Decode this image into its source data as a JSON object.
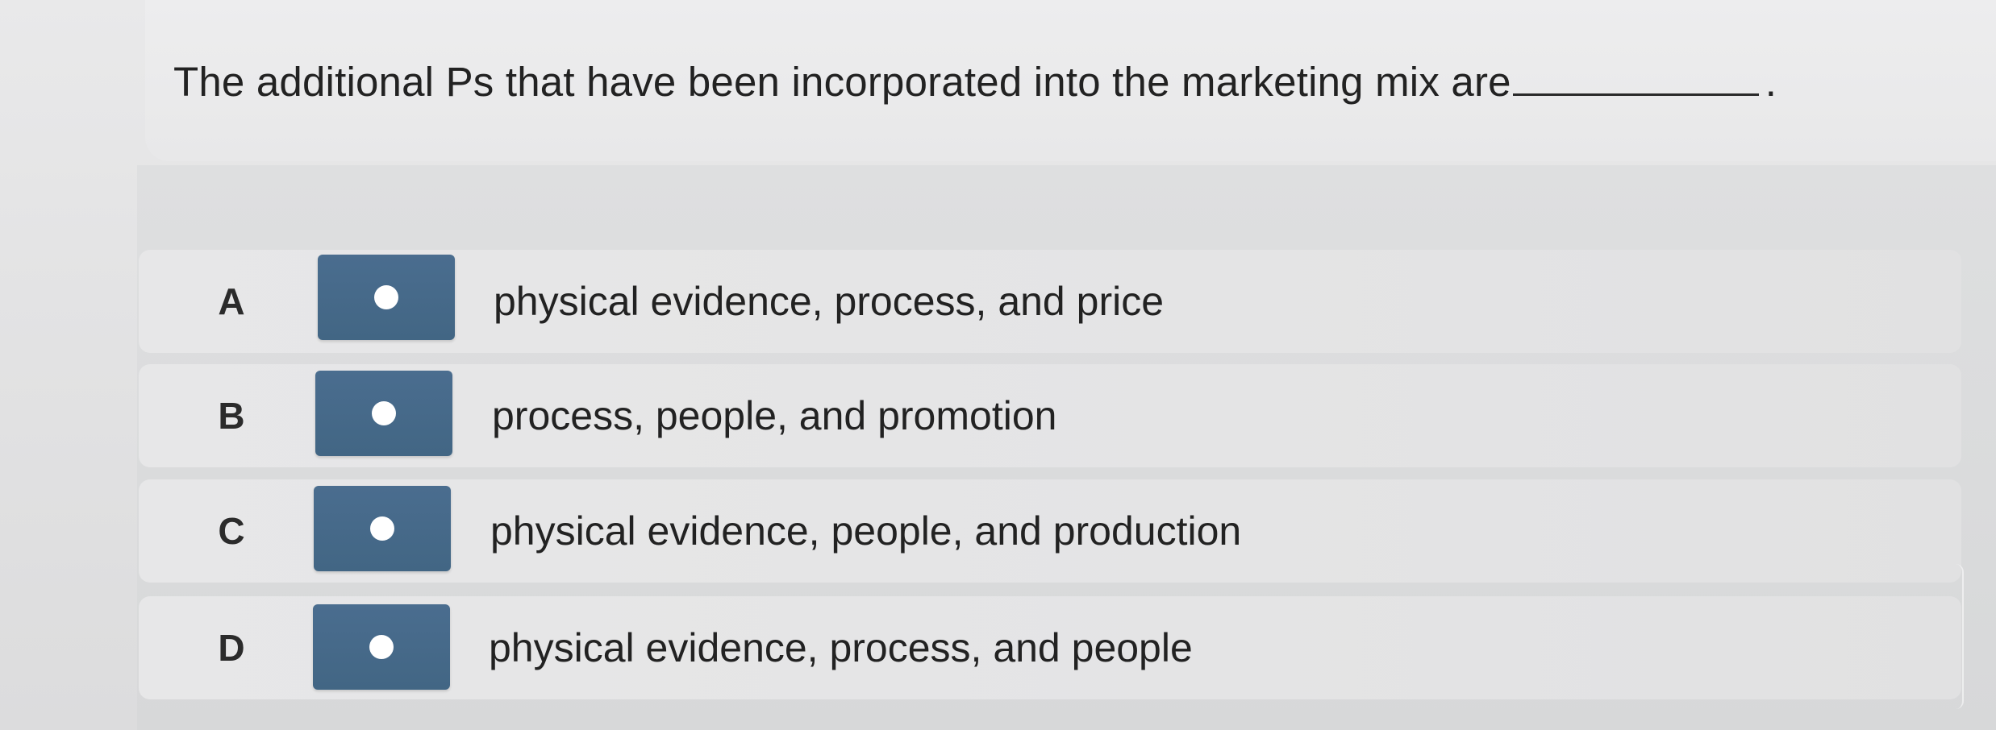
{
  "question": {
    "text": "The additional Ps that have been incorporated into the marketing mix are",
    "end_punct": "."
  },
  "choices": [
    {
      "letter": "A",
      "text": "physical evidence, process, and price"
    },
    {
      "letter": "B",
      "text": "process, people, and promotion"
    },
    {
      "letter": "C",
      "text": "physical evidence, people, and production"
    },
    {
      "letter": "D",
      "text": "physical evidence, process, and people"
    }
  ],
  "colors": {
    "radio_button": "#4a6d8f",
    "radio_dot": "#ffffff",
    "background": "#e6e6e7",
    "text": "#222222"
  }
}
